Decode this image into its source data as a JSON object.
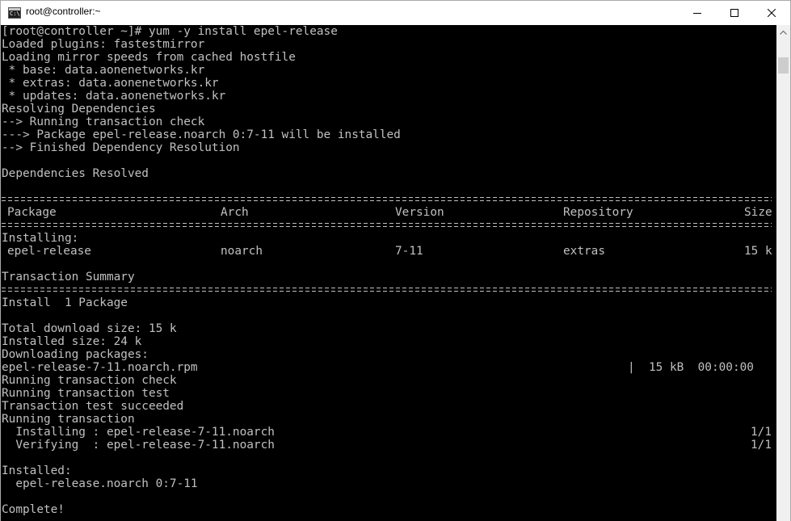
{
  "window": {
    "title": "root@controller:~",
    "icon": "command-prompt-icon",
    "icon_text": "C:\\"
  },
  "terminal": {
    "lines": [
      "[root@controller ~]# yum -y install epel-release",
      "Loaded plugins: fastestmirror",
      "Loading mirror speeds from cached hostfile",
      " * base: data.aonenetworks.kr",
      " * extras: data.aonenetworks.kr",
      " * updates: data.aonenetworks.kr",
      "Resolving Dependencies",
      "--> Running transaction check",
      "---> Package epel-release.noarch 0:7-11 will be installed",
      "--> Finished Dependency Resolution",
      "",
      "Dependencies Resolved",
      "",
      "SEP",
      " Package",
      "SEP",
      "Installing:",
      " epel-release",
      "",
      "Transaction Summary",
      "SEP",
      "Install  1 Package",
      "",
      "Total download size: 15 k",
      "Installed size: 24 k",
      "Downloading packages:",
      "epel-release-7-11.noarch.rpm",
      "Running transaction check",
      "Running transaction test",
      "Transaction test succeeded",
      "Running transaction",
      "  Installing : epel-release-7-11.noarch",
      "  Verifying  : epel-release-7-11.noarch",
      "",
      "Installed:",
      "  epel-release.noarch 0:7-11",
      "",
      "Complete!"
    ],
    "table": {
      "headers": [
        "Package",
        "Arch",
        "Version",
        "Repository",
        "Size"
      ],
      "row": [
        "epel-release",
        "noarch",
        "7-11",
        "extras",
        "15 k"
      ]
    },
    "download_progress": "|  15 kB  00:00:00",
    "install_step_progress": "1/1",
    "verify_step_progress": "1/1"
  },
  "colors": {
    "terminal_bg": "#000000",
    "terminal_fg": "#c0c0c0",
    "titlebar_bg": "#ffffff"
  }
}
